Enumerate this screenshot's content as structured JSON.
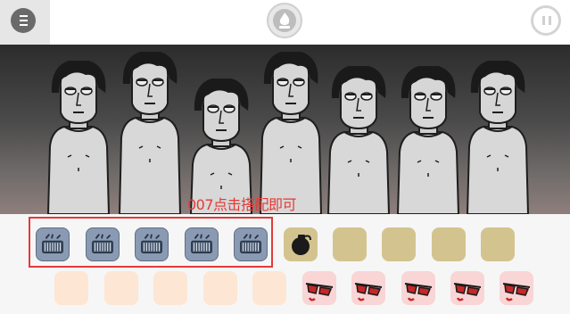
{
  "topbar": {
    "menu_icon": "menu-icon",
    "logo_icon": "flame-logo-icon",
    "pause_icon": "pause-icon"
  },
  "stage": {
    "performer_count": 7,
    "hint_text": "007点击搭配即可"
  },
  "palette": {
    "row1": [
      {
        "type": "beat",
        "icon": "keyboard-icon",
        "color": "#8a9ab3"
      },
      {
        "type": "beat",
        "icon": "keyboard-icon",
        "color": "#8a9ab3"
      },
      {
        "type": "beat",
        "icon": "keyboard-icon",
        "color": "#8a9ab3"
      },
      {
        "type": "beat",
        "icon": "keyboard-icon",
        "color": "#8a9ab3"
      },
      {
        "type": "beat",
        "icon": "keyboard-icon",
        "color": "#8a9ab3"
      },
      {
        "type": "effect",
        "icon": "grenade-icon",
        "color": "#d3c48f"
      },
      {
        "type": "effect",
        "icon": "",
        "color": "#d3c48f"
      },
      {
        "type": "effect",
        "icon": "",
        "color": "#d3c48f"
      },
      {
        "type": "effect",
        "icon": "",
        "color": "#d3c48f"
      },
      {
        "type": "effect",
        "icon": "",
        "color": "#d3c48f"
      }
    ],
    "row2": [
      {
        "type": "melody",
        "icon": "",
        "color": "#fde6d4"
      },
      {
        "type": "melody",
        "icon": "",
        "color": "#fde6d4"
      },
      {
        "type": "melody",
        "icon": "",
        "color": "#fde6d4"
      },
      {
        "type": "melody",
        "icon": "",
        "color": "#fde6d4"
      },
      {
        "type": "melody",
        "icon": "",
        "color": "#fde6d4"
      },
      {
        "type": "voice",
        "icon": "sunglasses-icon",
        "color": "#f9d5d5"
      },
      {
        "type": "voice",
        "icon": "sunglasses-icon",
        "color": "#f9d5d5"
      },
      {
        "type": "voice",
        "icon": "sunglasses-icon",
        "color": "#f9d5d5"
      },
      {
        "type": "voice",
        "icon": "sunglasses-icon",
        "color": "#f9d5d5"
      },
      {
        "type": "voice",
        "icon": "sunglasses-icon",
        "color": "#f9d5d5"
      }
    ]
  },
  "colors": {
    "accent_red": "#e53935",
    "stage_dark": "#2c2c2c",
    "skin": "#d9d9d9"
  }
}
